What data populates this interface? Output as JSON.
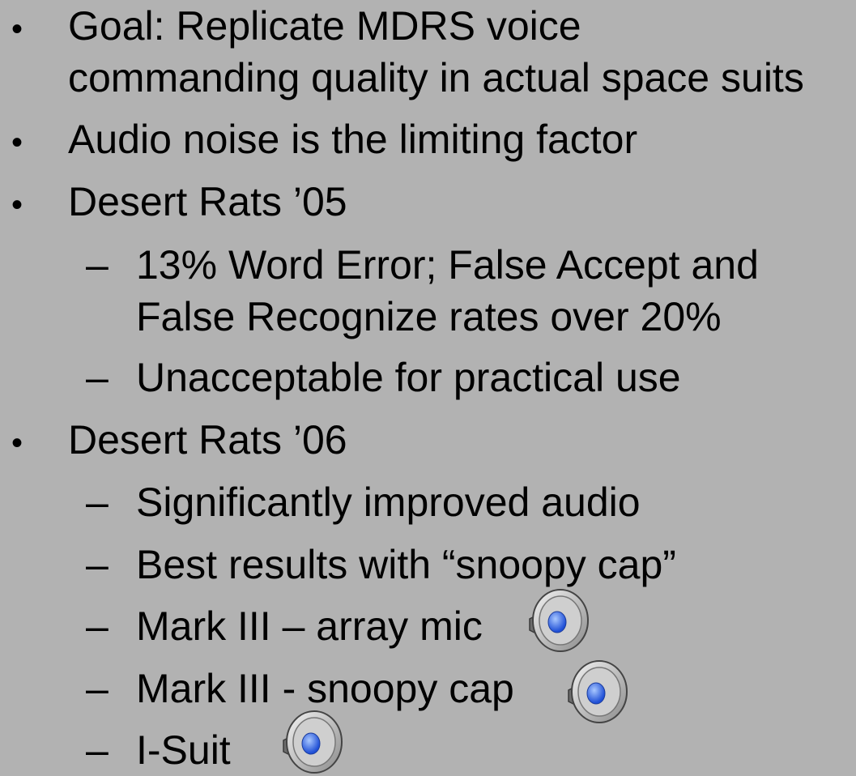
{
  "slide": {
    "bullet_l1": "•",
    "bullet_l2": "–",
    "items": [
      {
        "text_lines": [
          "Goal: Replicate MDRS voice",
          "commanding quality in actual space suits"
        ]
      },
      {
        "text_lines": [
          "Audio noise is the limiting factor"
        ]
      },
      {
        "text_lines": [
          "Desert Rats ’05"
        ],
        "sub": [
          {
            "text_lines": [
              "13% Word Error; False Accept and",
              "False Recognize rates over 20%"
            ]
          },
          {
            "text_lines": [
              "Unacceptable for practical use"
            ]
          }
        ]
      },
      {
        "text_lines": [
          "Desert Rats ’06"
        ],
        "sub": [
          {
            "text_lines": [
              "Significantly improved audio"
            ]
          },
          {
            "text_lines": [
              "Best results with “snoopy cap”"
            ]
          },
          {
            "text_lines": [
              "Mark III – array mic"
            ],
            "audio_icon": "speaker-icon"
          },
          {
            "text_lines": [
              "Mark III - snoopy cap"
            ],
            "audio_icon": "speaker-icon"
          },
          {
            "text_lines": [
              "I-Suit"
            ],
            "audio_icon": "speaker-icon"
          }
        ]
      }
    ]
  }
}
